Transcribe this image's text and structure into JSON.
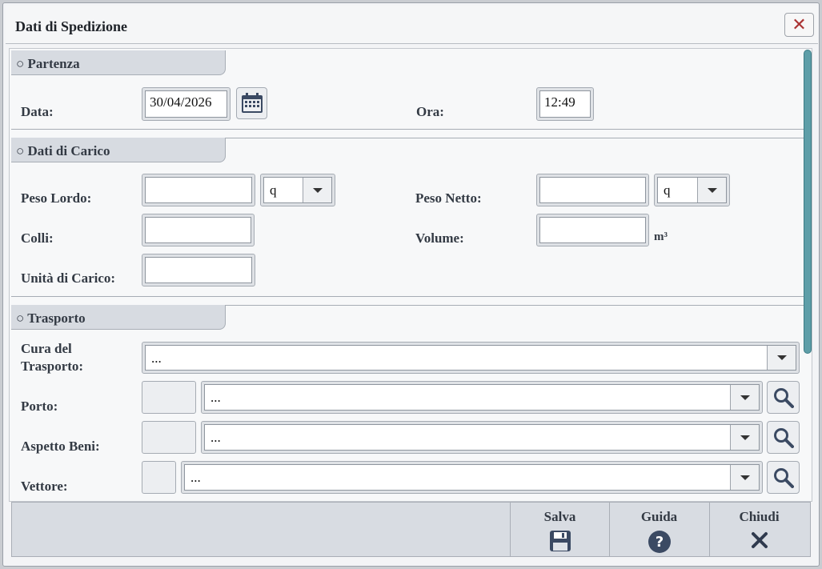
{
  "window": {
    "title": "Dati di Spedizione",
    "close_symbol": "✕"
  },
  "partenza": {
    "header": "○ Partenza",
    "data_label": "Data:",
    "data_value": "30/04/2026",
    "ora_label": "Ora:",
    "ora_value": "12:49"
  },
  "carico": {
    "header": "○ Dati di Carico",
    "peso_lordo_label": "Peso Lordo:",
    "peso_lordo_value": "",
    "peso_lordo_unit": "q",
    "peso_netto_label": "Peso Netto:",
    "peso_netto_value": "",
    "peso_netto_unit": "q",
    "colli_label": "Colli:",
    "colli_value": "",
    "volume_label": "Volume:",
    "volume_value": "",
    "volume_unit": "m³",
    "unita_label": "Unità di Carico:",
    "unita_value": ""
  },
  "trasporto": {
    "header": "○ Trasporto",
    "cura_label_1": "Cura del",
    "cura_label_2": "Trasporto:",
    "cura_value": "...",
    "porto_label": "Porto:",
    "porto_value": "...",
    "aspetto_label": "Aspetto Beni:",
    "aspetto_value": "...",
    "vettore_label": "Vettore:",
    "vettore_value": "..."
  },
  "footer": {
    "salva": "Salva",
    "guida": "Guida",
    "chiudi": "Chiudi"
  },
  "icons": {
    "calendar": "calendar-icon",
    "search": "search-icon",
    "save": "save-icon",
    "help": "help-icon",
    "close": "close-icon"
  },
  "colors": {
    "accent": "#5e9ea8",
    "icon": "#3b4a63",
    "close": "#aa3333"
  }
}
